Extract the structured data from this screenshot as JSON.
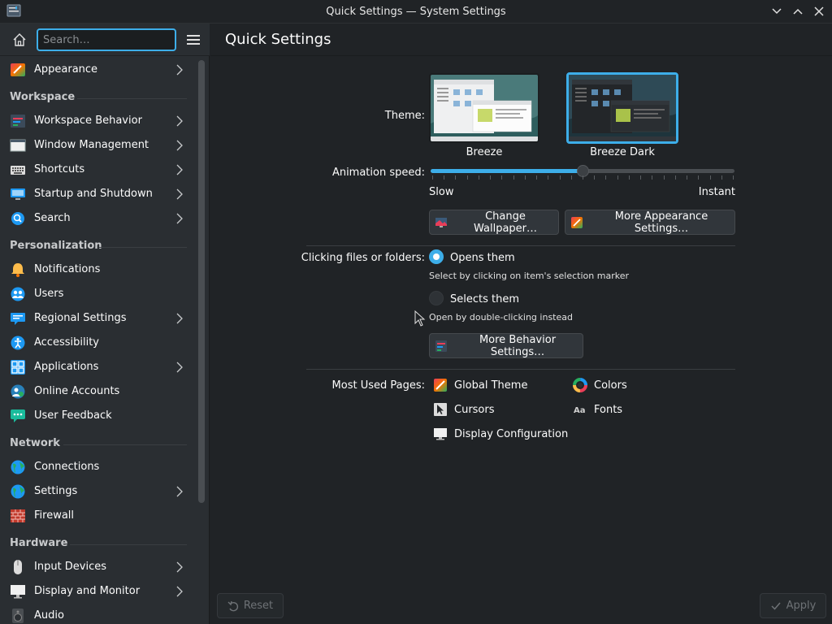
{
  "window": {
    "title": "Quick Settings — System Settings"
  },
  "sidebar": {
    "search_placeholder": "Search…",
    "items": [
      {
        "label": "Appearance",
        "icon": "appearance-icon",
        "chevron": true
      },
      {
        "label": "Workspace Behavior",
        "icon": "workspace-behavior-icon",
        "chevron": true
      },
      {
        "label": "Window Management",
        "icon": "window-management-icon",
        "chevron": true
      },
      {
        "label": "Shortcuts",
        "icon": "keyboard-icon",
        "chevron": true
      },
      {
        "label": "Startup and Shutdown",
        "icon": "startup-icon",
        "chevron": true
      },
      {
        "label": "Search",
        "icon": "search-icon",
        "chevron": true
      },
      {
        "label": "Notifications",
        "icon": "bell-icon",
        "chevron": false
      },
      {
        "label": "Users",
        "icon": "users-icon",
        "chevron": false
      },
      {
        "label": "Regional Settings",
        "icon": "regional-icon",
        "chevron": true
      },
      {
        "label": "Accessibility",
        "icon": "accessibility-icon",
        "chevron": false
      },
      {
        "label": "Applications",
        "icon": "applications-icon",
        "chevron": true
      },
      {
        "label": "Online Accounts",
        "icon": "online-accounts-icon",
        "chevron": false
      },
      {
        "label": "User Feedback",
        "icon": "feedback-icon",
        "chevron": false
      },
      {
        "label": "Connections",
        "icon": "globe-icon",
        "chevron": false
      },
      {
        "label": "Settings",
        "icon": "globe-settings-icon",
        "chevron": true
      },
      {
        "label": "Firewall",
        "icon": "firewall-icon",
        "chevron": false
      },
      {
        "label": "Input Devices",
        "icon": "mouse-icon",
        "chevron": true
      },
      {
        "label": "Display and Monitor",
        "icon": "monitor-icon",
        "chevron": true
      },
      {
        "label": "Audio",
        "icon": "speaker-icon",
        "chevron": false
      }
    ],
    "sections": {
      "workspace": "Workspace",
      "personalization": "Personalization",
      "network": "Network",
      "hardware": "Hardware"
    }
  },
  "main": {
    "page_title": "Quick Settings",
    "theme_label": "Theme:",
    "themes": [
      {
        "name": "Breeze",
        "selected": false
      },
      {
        "name": "Breeze Dark",
        "selected": true
      }
    ],
    "animation_label": "Animation speed:",
    "animation_min": "Slow",
    "animation_max": "Instant",
    "animation_level": 0.5,
    "change_wallpaper": "Change Wallpaper…",
    "more_appearance": "More Appearance Settings…",
    "clicking_label": "Clicking files or folders:",
    "opens_label": "Opens them",
    "opens_hint": "Select by clicking on item's selection marker",
    "selects_label": "Selects them",
    "selects_hint": "Open by double-clicking instead",
    "clicking_choice": "opens",
    "more_behavior": "More Behavior Settings…",
    "most_used_label": "Most Used Pages:",
    "most_used": [
      {
        "label": "Global Theme",
        "icon": "global-theme-icon"
      },
      {
        "label": "Colors",
        "icon": "colors-icon"
      },
      {
        "label": "Cursors",
        "icon": "cursors-icon"
      },
      {
        "label": "Fonts",
        "icon": "fonts-icon"
      },
      {
        "label": "Display Configuration",
        "icon": "display-icon"
      }
    ]
  },
  "footer": {
    "reset_label": "Reset",
    "apply_label": "Apply"
  },
  "colors": {
    "accent": "#3daee9",
    "background": "#202326",
    "sidebar": "#2a2e32"
  }
}
